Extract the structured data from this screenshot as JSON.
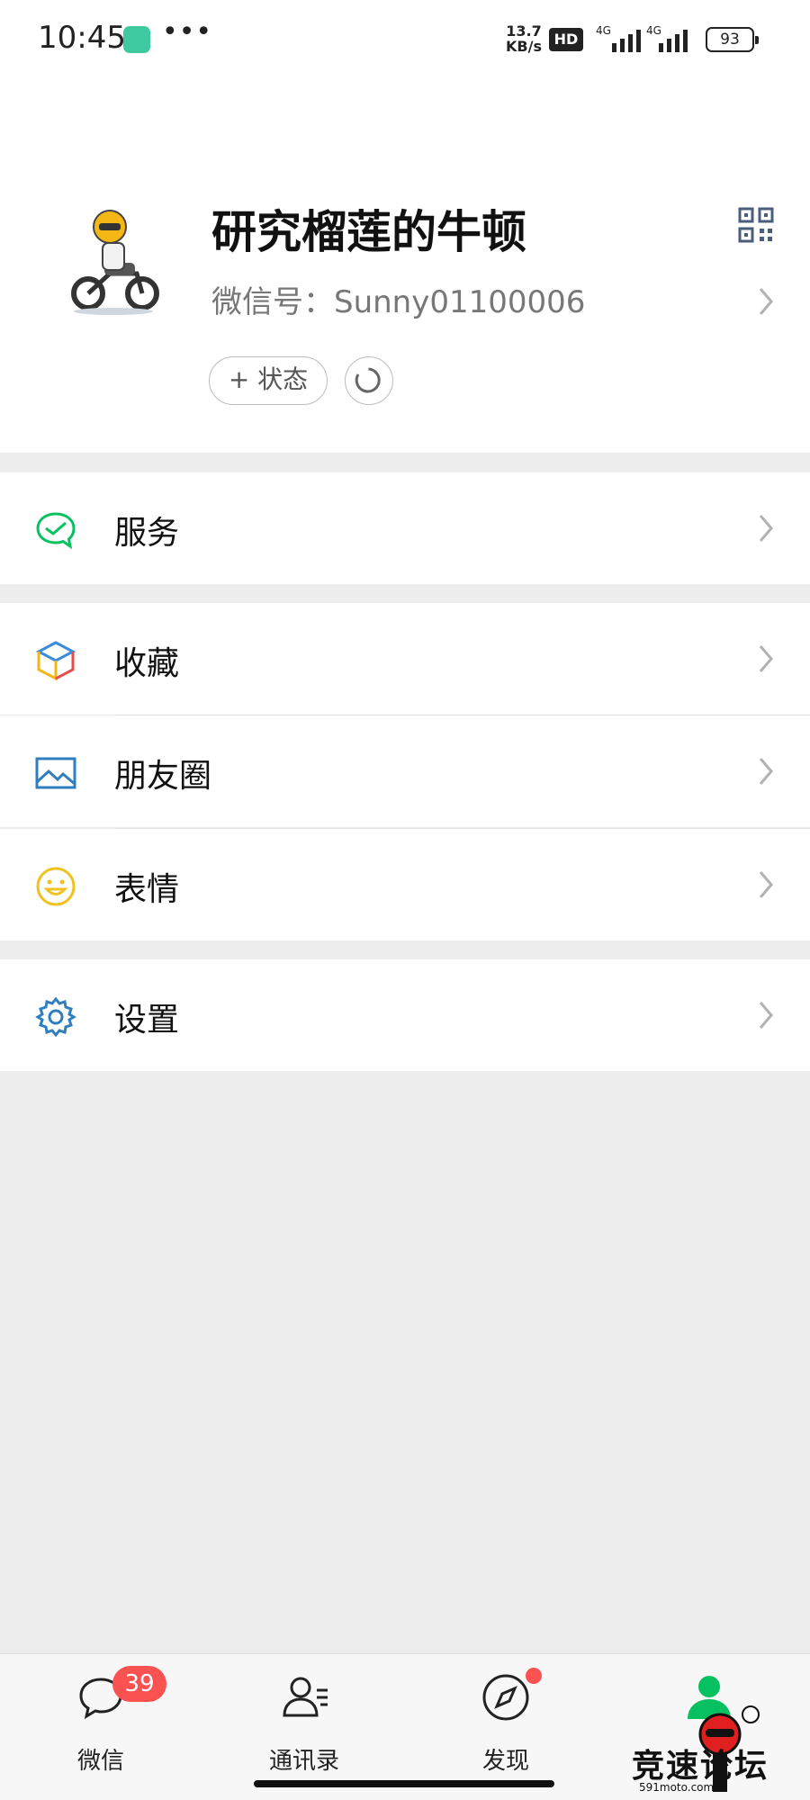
{
  "status_bar": {
    "time": "10:45",
    "dots": "•••",
    "net_speed_value": "13.7",
    "net_speed_unit": "KB/s",
    "hd_label": "HD",
    "signal1_label": "4G",
    "signal2_label": "4G",
    "battery": "93"
  },
  "profile": {
    "name": "研究榴莲的牛顿",
    "wechat_id": "微信号：Sunny01100006",
    "status_button": "+ 状态"
  },
  "menu": {
    "services": "服务",
    "favorites": "收藏",
    "moments": "朋友圈",
    "stickers": "表情",
    "settings": "设置"
  },
  "tabbar": {
    "chats": "微信",
    "chats_badge": "39",
    "contacts": "通讯录",
    "discover": "发现"
  },
  "watermark": {
    "text": "竞速论坛",
    "url": "591moto.com"
  },
  "colors": {
    "accent_green": "#07c160",
    "badge_red": "#fa5151",
    "background": "#ededed"
  }
}
